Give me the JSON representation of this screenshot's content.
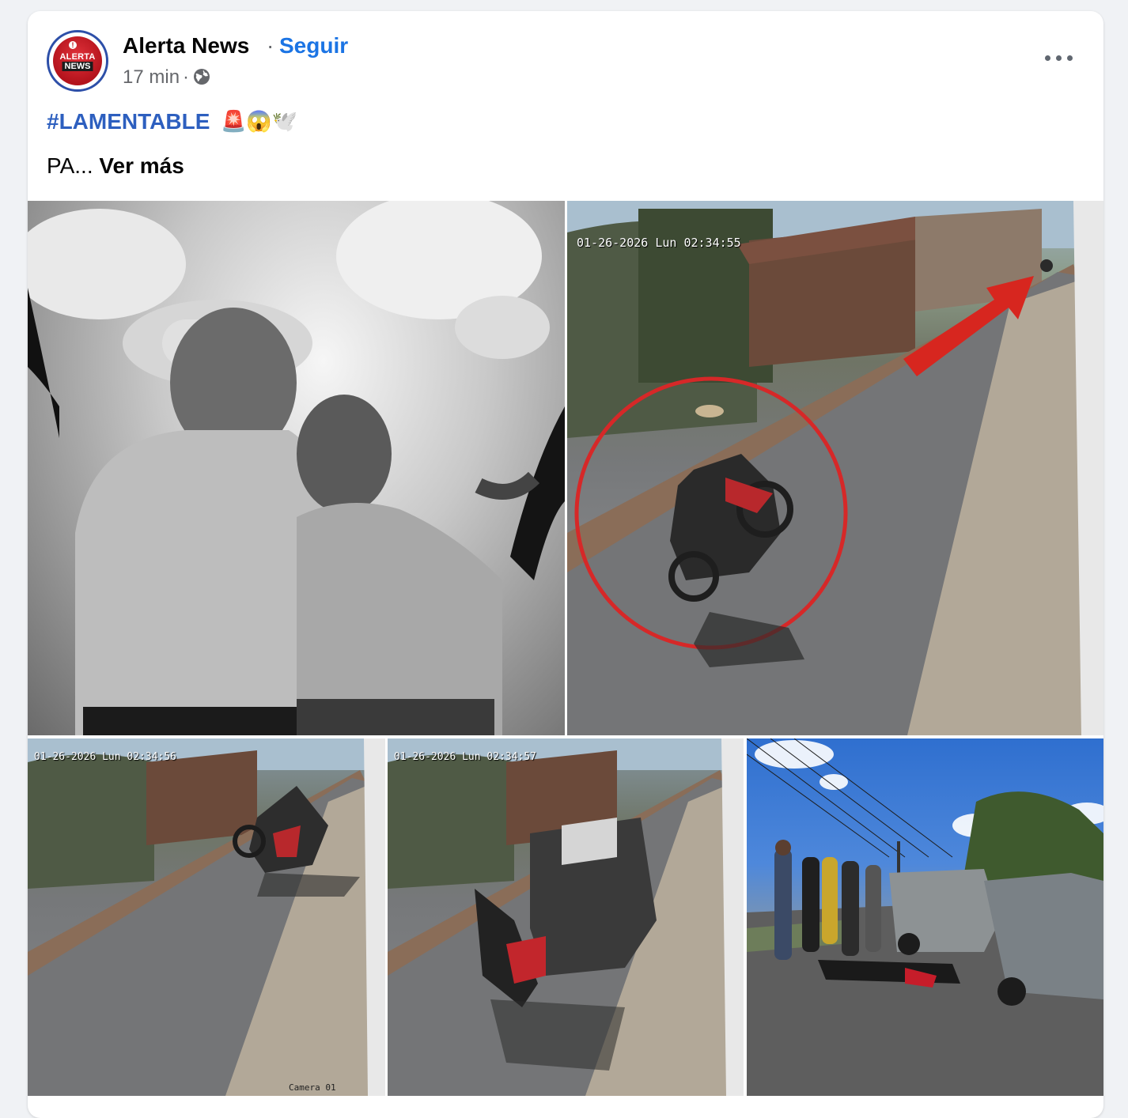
{
  "post": {
    "page_name": "Alerta News",
    "separator": "·",
    "follow_label": "Seguir",
    "time": "17 min",
    "meta_dot": "·",
    "avatar_text_1": "ALERTA",
    "avatar_text_2": "NEWS",
    "hashtag": "#LAMENTABLE",
    "emojis": "🚨😱🕊️",
    "body_text": "PA...",
    "see_more": "Ver más"
  },
  "photos": {
    "timestamp_1": "01-26-2026 Lun  02:34:55",
    "timestamp_2": "01-26-2026 Lun  02:34:56",
    "timestamp_3": "01-26-2026 Lun  02:34:57",
    "camera_label": "Camera 01"
  },
  "colors": {
    "link_blue": "#1b74e4",
    "hashtag_blue": "#2d5fbf",
    "brand_red": "#c0141c"
  }
}
